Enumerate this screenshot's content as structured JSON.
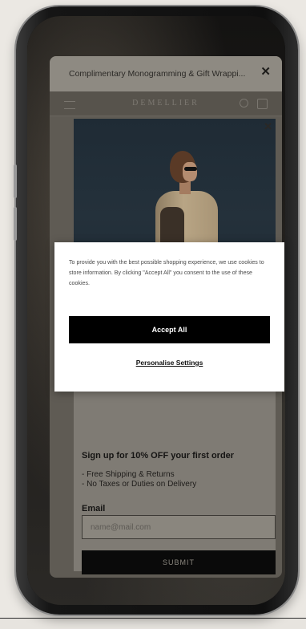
{
  "promo": {
    "text": "Complimentary Monogramming & Gift Wrappi...",
    "close": "✕"
  },
  "header": {
    "brand": "DEMELLIER"
  },
  "signup_popup": {
    "close": "✕",
    "heading": "Sign up for 10% OFF your first order",
    "perks": [
      "- Free Shipping & Returns",
      "- No Taxes or Duties on Delivery"
    ],
    "email_label": "Email",
    "email_placeholder": "name@mail.com",
    "email_value": "",
    "submit_label": "SUBMIT"
  },
  "cookie_banner": {
    "message": "To provide you with the best possible shopping experience, we use cookies to store information. By clicking \"Accept All\" you consent to the use of these cookies.",
    "accept_label": "Accept All",
    "settings_label": "Personalise Settings"
  },
  "colors": {
    "accept_button": "#000000",
    "banner_bg": "#ffffff",
    "overlay": "#5f5b54"
  },
  "icons": [
    "hamburger-icon",
    "search-icon",
    "bag-icon",
    "close-icon"
  ]
}
